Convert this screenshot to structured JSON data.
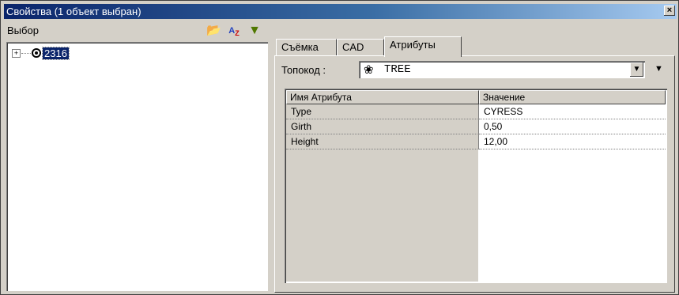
{
  "window": {
    "title": "Свойства (1 объект выбран)",
    "close_glyph": "×"
  },
  "left": {
    "header_label": "Выбор",
    "icons": [
      "folder-icon",
      "sort-az-icon",
      "filter-icon"
    ],
    "tree": {
      "expander": "⊞",
      "node_label": "2316"
    }
  },
  "tabs": [
    {
      "label": "Съёмка"
    },
    {
      "label": "CAD"
    },
    {
      "label": "Атрибуты",
      "active": true
    }
  ],
  "topocode": {
    "label": "Топокод :",
    "value": "TREE",
    "icon": "tree-code-icon"
  },
  "grid": {
    "headers": [
      "Имя Атрибута",
      "Значение"
    ],
    "rows": [
      {
        "name": "Type",
        "value": "CYRESS"
      },
      {
        "name": "Girth",
        "value": "0,50"
      },
      {
        "name": "Height",
        "value": "12,00"
      }
    ]
  }
}
